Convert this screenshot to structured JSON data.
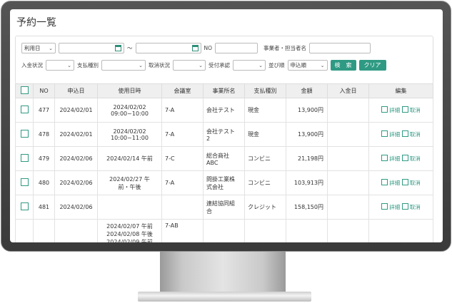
{
  "page_title": "予約一覧",
  "filters": {
    "date_type": "利用日",
    "tilde": "～",
    "no_label": "NO",
    "operator_label": "事業者・担当者名",
    "payment_in_status_label": "入金状況",
    "payment_type_label": "支払種別",
    "cancel_status_label": "取消状況",
    "accept_label": "受付承認",
    "sort_label": "並び順",
    "sort_value": "申込順",
    "search_button": "検　索",
    "clear_button": "クリア"
  },
  "table": {
    "headers": [
      "",
      "NO",
      "申込日",
      "使用日時",
      "会議室",
      "事業所名",
      "支払種別",
      "金額",
      "入金日",
      "編集"
    ],
    "edit_label": "詳細",
    "cancel_label": "取消",
    "rows": [
      {
        "no": "477",
        "applied": "2024/02/01",
        "use_l1": "2024/02/02",
        "use_l2": "09:00~10:00",
        "use_l3": "",
        "room": "7-A",
        "office_l1": "会社テスト",
        "office_l2": "",
        "payment": "現金",
        "amount": "13,900円",
        "paid": ""
      },
      {
        "no": "478",
        "applied": "2024/02/01",
        "use_l1": "2024/02/02",
        "use_l2": "10:00~11:00",
        "use_l3": "",
        "room": "7-A",
        "office_l1": "会社テスト",
        "office_l2": "2",
        "payment": "現金",
        "amount": "13,900円",
        "paid": ""
      },
      {
        "no": "479",
        "applied": "2024/02/06",
        "use_l1": "2024/02/14 午前",
        "use_l2": "",
        "use_l3": "",
        "room": "7-C",
        "office_l1": "総合商社",
        "office_l2": "ABC",
        "payment": "コンビニ",
        "amount": "21,198円",
        "paid": ""
      },
      {
        "no": "480",
        "applied": "2024/02/06",
        "use_l1": "2024/02/27 午",
        "use_l2": "前・午後",
        "use_l3": "",
        "room": "7-A",
        "office_l1": "問掛工業株",
        "office_l2": "式会社",
        "payment": "コンビニ",
        "amount": "103,913円",
        "paid": ""
      },
      {
        "no": "481",
        "applied": "2024/02/06",
        "use_l1": "",
        "use_l2": "",
        "use_l3": "",
        "room": "",
        "office_l1": "連結協同組",
        "office_l2": "合",
        "payment": "クレジット",
        "amount": "158,150円",
        "paid": ""
      },
      {
        "no": "",
        "applied": "",
        "use_l1": "2024/02/07 午前",
        "use_l2": "2024/02/08 午後",
        "use_l3": "2024/02/09 午前",
        "room": "7-AB",
        "office_l1": "",
        "office_l2": "",
        "payment": "",
        "amount": "",
        "paid": ""
      }
    ]
  }
}
